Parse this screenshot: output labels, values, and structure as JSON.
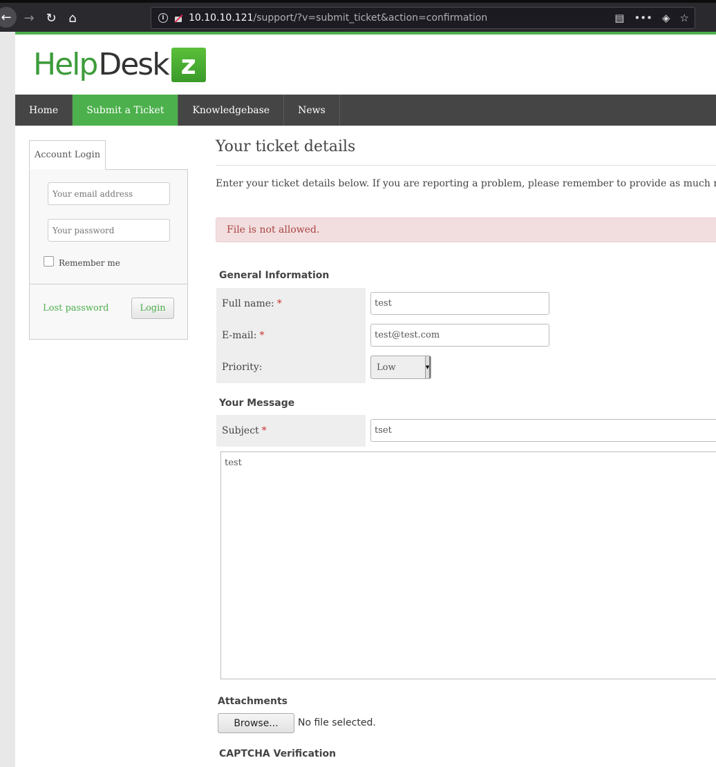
{
  "browser": {
    "url_host": "10.10.10.121",
    "url_path": "/support/?v=submit_ticket&action=confirmation"
  },
  "logo": {
    "help": "Help",
    "desk": "Desk",
    "z": "z"
  },
  "topnav": {
    "items": [
      {
        "label": "Home",
        "active": false
      },
      {
        "label": "Submit a Ticket",
        "active": true
      },
      {
        "label": "Knowledgebase",
        "active": false
      },
      {
        "label": "News",
        "active": false
      }
    ]
  },
  "login": {
    "tab_label": "Account Login",
    "email_placeholder": "Your email address",
    "password_placeholder": "Your password",
    "remember_label": "Remember me",
    "lost_password": "Lost password",
    "login_button": "Login"
  },
  "main": {
    "title": "Your ticket details",
    "intro": "Enter your ticket details below. If you are reporting a problem, please remember to provide as much relevant information as possible.",
    "alert": "File is not allowed."
  },
  "general_info": {
    "heading": "General Information",
    "fullname_label": "Full name:",
    "fullname_value": "test",
    "email_label": "E-mail:",
    "email_value": "test@test.com",
    "priority_label": "Priority:",
    "priority_value": "Low",
    "required_mark": "*"
  },
  "message": {
    "heading": "Your Message",
    "subject_label": "Subject",
    "subject_value": "tset",
    "body_value": "test"
  },
  "attachments": {
    "heading": "Attachments",
    "browse_button": "Browse...",
    "no_file": "No file selected."
  },
  "captcha": {
    "heading": "CAPTCHA Verification"
  },
  "colors": {
    "brand_green": "#4cb04c",
    "nav_dark": "#454545",
    "alert_bg": "#f2dede",
    "alert_text": "#a94442"
  }
}
